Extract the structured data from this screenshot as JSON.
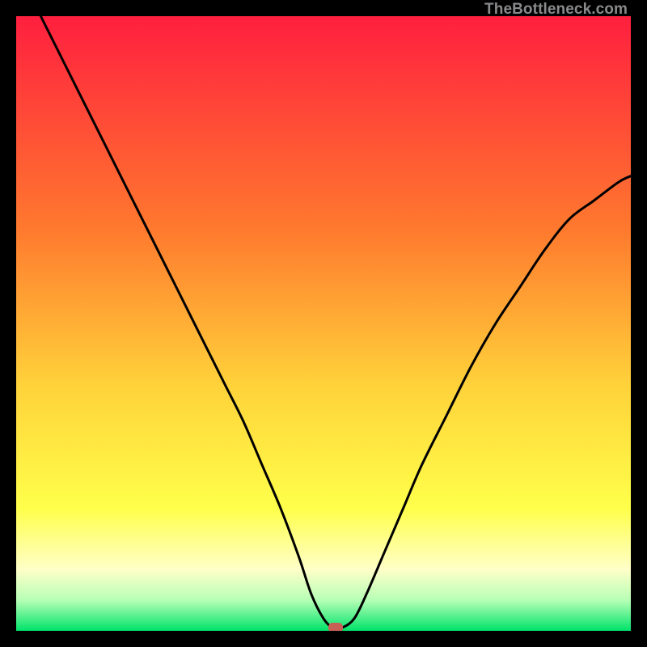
{
  "watermark": "TheBottleneck.com",
  "colors": {
    "red": "#ff1f3f",
    "orange": "#ffa52a",
    "yellow": "#ffef3a",
    "paleyellow": "#ffffc2",
    "lightgreen": "#b7ffb6",
    "green": "#00e36a",
    "marker": "#c86058",
    "curve": "#000000",
    "frame": "#000000"
  },
  "gradient_stops": [
    {
      "offset": 0.0,
      "color": "#ff1f3f"
    },
    {
      "offset": 0.35,
      "color": "#ff7a2e"
    },
    {
      "offset": 0.6,
      "color": "#ffd23a"
    },
    {
      "offset": 0.8,
      "color": "#ffff4a"
    },
    {
      "offset": 0.9,
      "color": "#ffffc8"
    },
    {
      "offset": 0.95,
      "color": "#b7ffb6"
    },
    {
      "offset": 1.0,
      "color": "#00e36a"
    }
  ],
  "chart_data": {
    "type": "line",
    "title": "",
    "xlabel": "",
    "ylabel": "",
    "xlim": [
      0,
      100
    ],
    "ylim": [
      0,
      100
    ],
    "series": [
      {
        "name": "bottleneck-curve",
        "x": [
          4,
          7,
          10,
          13,
          16,
          19,
          22,
          25,
          28,
          31,
          34,
          37,
          40,
          43,
          46,
          48,
          50,
          51.5,
          53,
          55,
          57,
          60,
          63,
          66,
          70,
          74,
          78,
          82,
          86,
          90,
          94,
          98,
          100
        ],
        "y": [
          100,
          94,
          88,
          82,
          76,
          70,
          64,
          58,
          52,
          46,
          40,
          34,
          27,
          20,
          12,
          6,
          2,
          0.5,
          0.5,
          2,
          6,
          13,
          20,
          27,
          35,
          43,
          50,
          56,
          62,
          67,
          70,
          73,
          74
        ]
      }
    ],
    "marker": {
      "x": 52,
      "y": 0.5
    }
  }
}
